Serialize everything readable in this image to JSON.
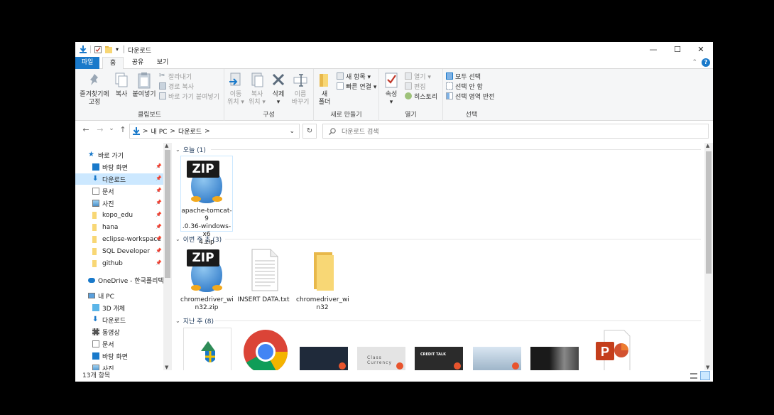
{
  "window": {
    "title": "다운로드",
    "qa_dropdown": "▾",
    "controls": {
      "minimize": "—",
      "maximize": "☐",
      "close": "✕"
    }
  },
  "ribbon_tabs": [
    "파일",
    "홈",
    "공유",
    "보기"
  ],
  "ribbon": {
    "clipboard": {
      "label": "클립보드",
      "pin": "즐겨찾기에\n고정",
      "copy": "복사",
      "paste": "붙여넣기",
      "cut": "잘라내기",
      "copy_path": "경로 복사",
      "paste_shortcut": "바로 가기 붙여넣기"
    },
    "organize": {
      "label": "구성",
      "move_to": "이동\n위치 ▾",
      "copy_to": "복사\n위치 ▾",
      "delete": "삭제\n▾",
      "rename": "이름\n바꾸기"
    },
    "new": {
      "label": "새로 만들기",
      "new_folder": "새\n폴더",
      "new_item": "새 항목 ▾",
      "easy_access": "빠른 연결 ▾"
    },
    "open": {
      "label": "열기",
      "properties": "속성\n▾",
      "open": "열기 ▾",
      "edit": "편집",
      "history": "히스토리"
    },
    "select": {
      "label": "선택",
      "select_all": "모두 선택",
      "select_none": "선택 안 함",
      "invert": "선택 영역 반전"
    }
  },
  "address": {
    "back": "←",
    "forward": "→",
    "recent": "⌄",
    "up": "↑",
    "path": [
      "내 PC",
      "다운로드"
    ],
    "sep": ">",
    "dropdown": "⌄",
    "refresh": "↻",
    "search_placeholder": "다운로드 검색"
  },
  "nav": {
    "quick_access": "바로 가기",
    "quick_items": [
      {
        "label": "바탕 화면",
        "pinned": true
      },
      {
        "label": "다운로드",
        "pinned": true,
        "selected": true
      },
      {
        "label": "문서",
        "pinned": true
      },
      {
        "label": "사진",
        "pinned": true
      },
      {
        "label": "kopo_edu",
        "pinned": true
      },
      {
        "label": "hana",
        "pinned": true
      },
      {
        "label": "eclipse-workspace",
        "pinned": true
      },
      {
        "label": "SQL Developer",
        "pinned": true
      },
      {
        "label": "github",
        "pinned": true
      }
    ],
    "onedrive": "OneDrive - 한국폴리텍대",
    "this_pc": "내 PC",
    "pc_items": [
      "3D 개체",
      "다운로드",
      "동영상",
      "문서",
      "바탕 화면",
      "사진"
    ]
  },
  "groups": [
    {
      "title": "오늘 (1)",
      "files": [
        "apache-tomcat-9.0.36-windows-x64.zip"
      ]
    },
    {
      "title": "이번 주 초 (3)",
      "files": [
        "chromedriver_win32.zip",
        "INSERT DATA.txt",
        "chromedriver_win32"
      ]
    },
    {
      "title": "지난 주 (8)"
    }
  ],
  "file_labels": {
    "tomcat": [
      "apache-tomcat-9",
      ".0.36-windows-x6",
      "4.zip"
    ],
    "chromezip": [
      "chromedriver_wi",
      "n32.zip"
    ],
    "txt": [
      "INSERT DATA.txt"
    ],
    "folder": [
      "chromedriver_wi",
      "n32"
    ]
  },
  "zip_text": "ZIP",
  "thumb_texts": [
    "CREDIT TALK",
    "Class Currency"
  ],
  "status": "13개 항목",
  "colors": {
    "accent": "#1979ca",
    "selected_bg": "#cce8ff",
    "folder": "#f8d775",
    "group_header": "#1e395b"
  }
}
